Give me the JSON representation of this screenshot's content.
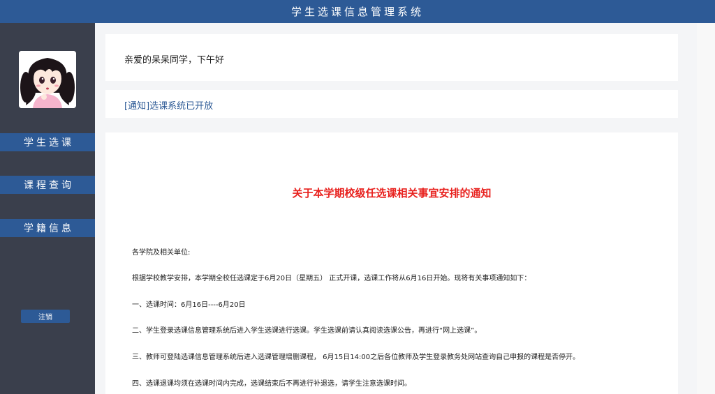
{
  "header": {
    "title": "学生选课信息管理系统"
  },
  "sidebar": {
    "avatar_icon": "girl-avatar-icon",
    "items": [
      {
        "label": "学生选课"
      },
      {
        "label": "课程查询"
      },
      {
        "label": "学籍信息"
      }
    ],
    "logout_label": "注销"
  },
  "main": {
    "greeting": "亲爱的呆呆同学，下午好",
    "notice": "[通知]选课系统已开放",
    "article": {
      "title": "关于本学期校级任选课相关事宜安排的通知",
      "paragraphs": [
        "各学院及相关单位:",
        "根据学校教学安排，本学期全校任选课定于6月20日（星期五） 正式开课，选课工作将从6月16日开始。现将有关事项通知如下：",
        "一、选课时间：6月16日----6月20日",
        "二、学生登录选课信息管理系统后进入学生选课进行选课。学生选课前请认真阅读选课公告，再进行“网上选课”。",
        "三、教师可登陆选课信息管理系统后进入选课管理增删课程， 6月15日14:00之后各位教师及学生登录教务处网站查询自己申报的课程是否停开。",
        "四、选课退课均须在选课时间内完成，选课结束后不再进行补退选，请学生注意选课时间。"
      ]
    }
  },
  "colors": {
    "primary": "#2d5a96",
    "sidebar_bg": "#3a3f4c",
    "title_red": "#e8211e",
    "page_bg": "#f4f5f7"
  }
}
